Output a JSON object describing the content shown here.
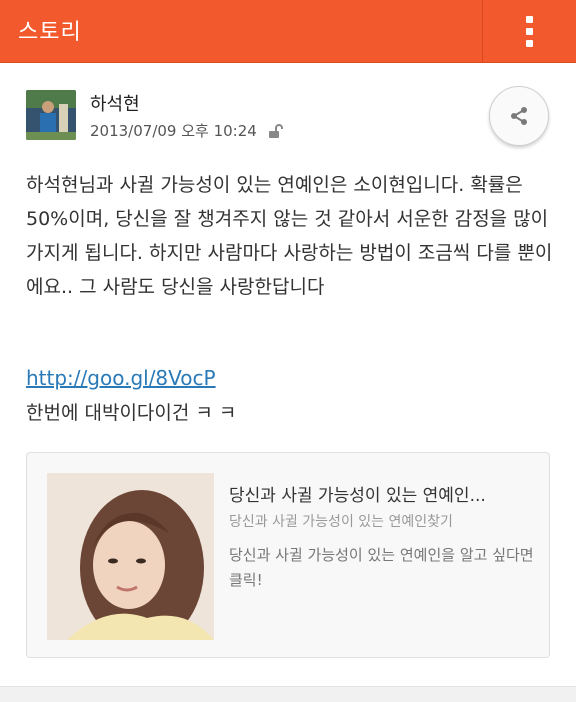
{
  "header": {
    "title": "스토리",
    "menu_icon": "overflow-menu-icon",
    "color": "#f2592c"
  },
  "post": {
    "author": "하석현",
    "timestamp": "2013/07/09 오후 10:24",
    "privacy_icon": "unlock-icon",
    "share_icon": "share-icon",
    "body": "하석현님과 사귈 가능성이 있는 연예인은 소이현입니다. 확률은 50%이며, 당신을 잘 챙겨주지 않는 것 같아서 서운한 감정을 많이 가지게 됩니다. 하지만 사람마다 사랑하는 방법이 조금씩 다를 뿐이에요.. 그 사람도 당신을 사랑한답니다",
    "link": "http://goo.gl/8VocP",
    "after_link": "한번에 대박이다이건  ㅋ ㅋ"
  },
  "card": {
    "title": "당신과 사귈 가능성이 있는 연예인...",
    "subtitle": "당신과 사귈 가능성이 있는 연예인찾기",
    "description": "당신과 사귈 가능성이 있는 연예인을 알고 싶다면 클릭!"
  }
}
